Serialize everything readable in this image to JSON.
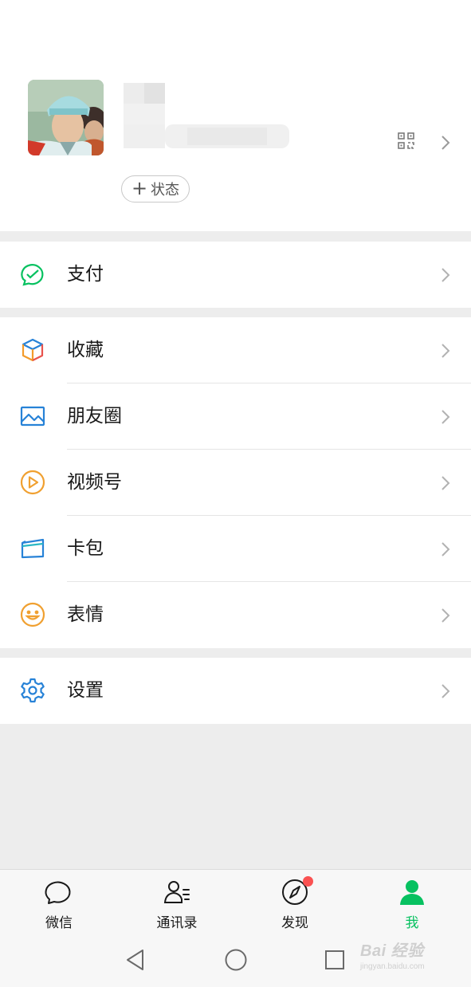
{
  "profile": {
    "status_button_label": "状态",
    "status_button_plus": "+",
    "qr_icon": "qr-code-icon",
    "chevron_icon": "chevron-right-icon"
  },
  "menu_groups": [
    {
      "items": [
        {
          "label": "支付",
          "icon": "pay-icon",
          "color": "#07c160"
        }
      ]
    },
    {
      "items": [
        {
          "label": "收藏",
          "icon": "favorites-cube-icon",
          "color": "#f39b2b"
        },
        {
          "label": "朋友圈",
          "icon": "moments-image-icon",
          "color": "#2782d7"
        },
        {
          "label": "视频号",
          "icon": "channels-play-icon",
          "color": "#f0a030"
        },
        {
          "label": "卡包",
          "icon": "card-wallet-icon",
          "color": "#2782d7"
        },
        {
          "label": "表情",
          "icon": "sticker-smile-icon",
          "color": "#f0a030"
        }
      ]
    },
    {
      "items": [
        {
          "label": "设置",
          "icon": "settings-gear-icon",
          "color": "#2782d7"
        }
      ]
    }
  ],
  "tabbar": {
    "tabs": [
      {
        "label": "微信",
        "icon": "chat-bubble-icon",
        "active": false
      },
      {
        "label": "通讯录",
        "icon": "contacts-icon",
        "active": false
      },
      {
        "label": "发现",
        "icon": "discover-compass-icon",
        "active": false,
        "badge_dot": true
      },
      {
        "label": "我",
        "icon": "me-person-icon",
        "active": true
      }
    ],
    "active_color": "#07c160",
    "badge_color": "#fa5151"
  },
  "system_nav": {
    "buttons": [
      "back-triangle-icon",
      "home-circle-icon",
      "recents-square-icon"
    ]
  },
  "watermark": {
    "main": "Bai 经验",
    "sub": "jingyan.baidu.com"
  }
}
